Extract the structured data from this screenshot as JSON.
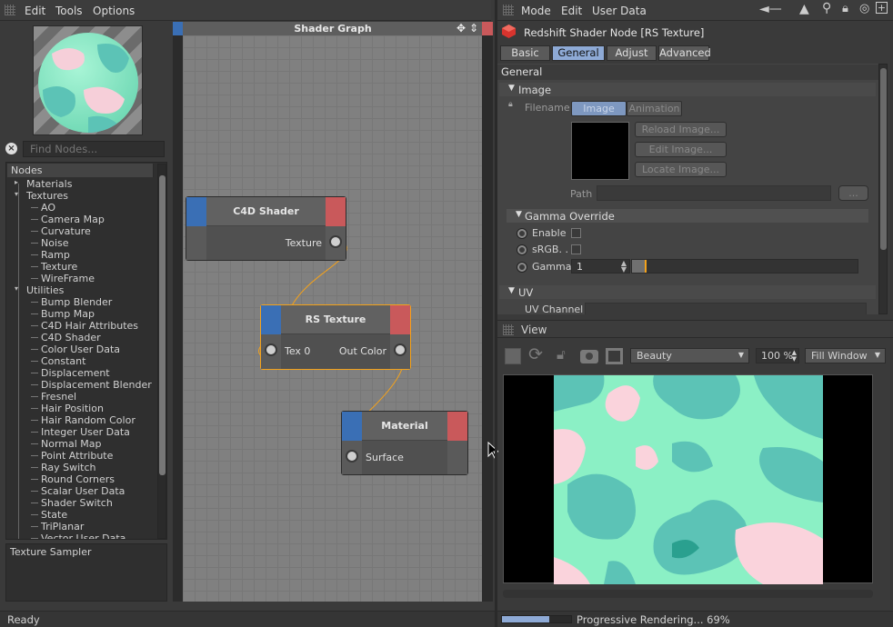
{
  "left_menu": {
    "edit": "Edit",
    "tools": "Tools",
    "options": "Options"
  },
  "search": {
    "placeholder": "Find Nodes..."
  },
  "nodes_panel": {
    "header": "Nodes",
    "items": [
      {
        "label": "Materials",
        "level": 0
      },
      {
        "label": "Textures",
        "level": 0
      },
      {
        "label": "AO",
        "level": 1
      },
      {
        "label": "Camera Map",
        "level": 1
      },
      {
        "label": "Curvature",
        "level": 1
      },
      {
        "label": "Noise",
        "level": 1
      },
      {
        "label": "Ramp",
        "level": 1
      },
      {
        "label": "Texture",
        "level": 1
      },
      {
        "label": "WireFrame",
        "level": 1
      },
      {
        "label": "Utilities",
        "level": 0
      },
      {
        "label": "Bump Blender",
        "level": 1
      },
      {
        "label": "Bump Map",
        "level": 1
      },
      {
        "label": "C4D Hair Attributes",
        "level": 1
      },
      {
        "label": "C4D Shader",
        "level": 1
      },
      {
        "label": "Color User Data",
        "level": 1
      },
      {
        "label": "Constant",
        "level": 1
      },
      {
        "label": "Displacement",
        "level": 1
      },
      {
        "label": "Displacement Blender",
        "level": 1
      },
      {
        "label": "Fresnel",
        "level": 1
      },
      {
        "label": "Hair Position",
        "level": 1
      },
      {
        "label": "Hair Random Color",
        "level": 1
      },
      {
        "label": "Integer User Data",
        "level": 1
      },
      {
        "label": "Normal Map",
        "level": 1
      },
      {
        "label": "Point Attribute",
        "level": 1
      },
      {
        "label": "Ray Switch",
        "level": 1
      },
      {
        "label": "Round Corners",
        "level": 1
      },
      {
        "label": "Scalar User Data",
        "level": 1
      },
      {
        "label": "Shader Switch",
        "level": 1
      },
      {
        "label": "State",
        "level": 1
      },
      {
        "label": "TriPlanar",
        "level": 1
      },
      {
        "label": "Vector User Data",
        "level": 1
      }
    ]
  },
  "description": "Texture Sampler",
  "graph": {
    "title": "Shader Graph",
    "c4d_shader": {
      "title": "C4D Shader",
      "out_port": "Texture"
    },
    "rs_texture": {
      "title": "RS Texture",
      "in_port": "Tex 0",
      "out_port": "Out Color"
    },
    "material": {
      "title": "Material",
      "in_port": "Surface"
    }
  },
  "status_left": "Ready",
  "attr_menu": {
    "mode": "Mode",
    "edit": "Edit",
    "user_data": "User Data"
  },
  "attr": {
    "node_title": "Redshift Shader Node [RS Texture]",
    "tabs": [
      "Basic",
      "General",
      "Adjust",
      "Advanced"
    ],
    "active_tab": "General",
    "group_general": "General",
    "image_section": "Image",
    "filename_label": "Filename",
    "file_tabs": {
      "image": "Image",
      "animation": "Animation"
    },
    "reload": "Reload Image...",
    "edit_image": "Edit Image...",
    "locate": "Locate Image...",
    "path_label": "Path",
    "path_btn": "...",
    "gamma_section": "Gamma Override",
    "enable": "Enable",
    "srgb": "sRGB. .",
    "gamma_label": "Gamma",
    "gamma_value": "1",
    "uv_section": "UV",
    "uv_channel": "UV Channel"
  },
  "view": {
    "title": "View",
    "aov": "Beauty",
    "zoom": "100 %",
    "fit": "Fill Window",
    "progress_text": "Progressive Rendering... 69%",
    "progress": 0.69
  },
  "colors": {
    "accent": "#f4a21b",
    "port_blue": "#3a6fb5",
    "port_red": "#c9595b",
    "tab_active": "#8eaad6",
    "mint": "#8bf0c5",
    "teal": "#5cc3b6",
    "pink": "#fad3dc"
  }
}
